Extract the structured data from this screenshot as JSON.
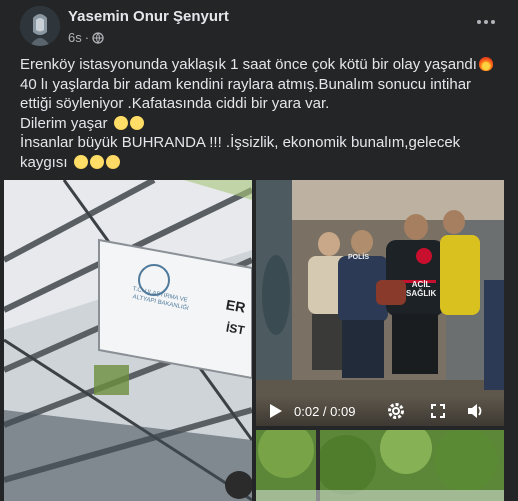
{
  "post": {
    "author": "Yasemin Onur Şenyurt",
    "time": "6s",
    "lines": [
      "Erenköy istasyonunda yaklaşık 1 saat önce çok kötü bir olay yaşandı",
      "40 lı yaşlarda bir adam kendini raylara atmış.Bunalım sonucu intihar",
      "ettiği söyleniyor .Kafatasında ciddi bir yara var.",
      "Dilerim yaşar",
      "İnsanlar büyük BUHRANDA !!! .İşsizlik, ekonomik bunalım,gelecek",
      "kaygısı"
    ]
  },
  "media": {
    "sign_text": [
      "T.C. ULAŞTIRMA VE",
      "ALTYAPI BAKANLIĞI"
    ],
    "sign_large": [
      "ER",
      "İST"
    ],
    "jacket_text": [
      "ACİL",
      "SAĞLIK"
    ],
    "police_text": "POLİS",
    "video": {
      "current": "0:02",
      "separator": " / ",
      "duration": "0:09"
    }
  },
  "icons": {
    "globe": "globe-icon",
    "more": "more-options-icon",
    "play": "play-icon",
    "settings": "settings-icon",
    "fullscreen": "fullscreen-icon",
    "volume": "volume-icon"
  }
}
